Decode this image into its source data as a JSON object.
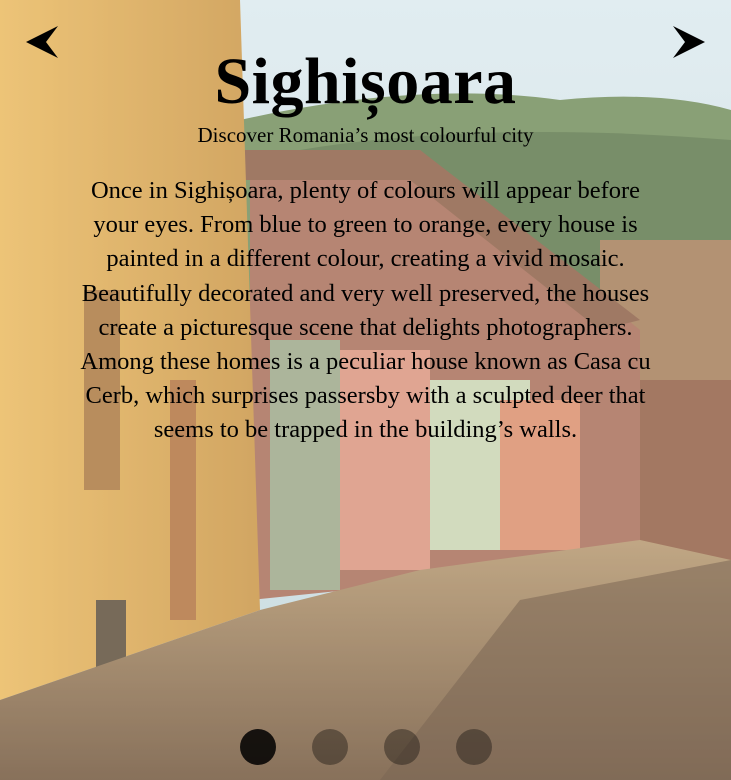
{
  "slide": {
    "title": "Sighișoara",
    "subtitle": "Discover Romania’s most colourful city",
    "body": "Once in Sighișoara, plenty of colours will appear before your eyes. From blue to green to orange, every house is painted in a different colour, creating a vivid mosaic. Beautifully decorated and very well preserved, the houses create a picturesque scene that delights photographers. Among these homes is a peculiar house known as Casa cu Cerb, which surprises passersby with a sculpted deer that seems to be trapped in the building’s walls."
  },
  "navigation": {
    "prev_icon": "arrow-left-icon",
    "next_icon": "arrow-right-icon"
  },
  "pagination": {
    "total": 4,
    "active_index": 0
  },
  "colors": {
    "sky": "#cfe3ea",
    "wall_yellow": "#d9a64a",
    "road": "#8a6a45",
    "text": "#000000"
  }
}
